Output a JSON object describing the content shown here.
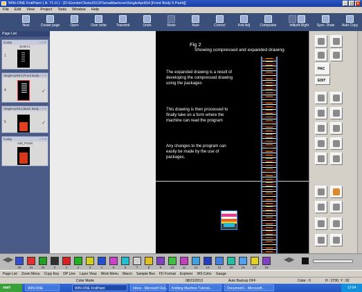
{
  "window": {
    "title": "WIN-ONE KnitPaint ( A: 71 H ) - [D:\\Gordon\\Tests2013\\TamaMaehove\\SingleAprilS4 [Front Body 5 Paint]]",
    "controls": [
      "_",
      "□",
      "×"
    ]
  },
  "menu": [
    "File",
    "Edit",
    "View",
    "Project",
    "Tools",
    "Window",
    "Help"
  ],
  "toolbar": {
    "left": [
      {
        "label": "New",
        "icon": "new-file-icon"
      },
      {
        "label": "Create page",
        "icon": "create-page-icon"
      },
      {
        "label": "Open",
        "icon": "open-folder-icon"
      },
      {
        "label": "Over write",
        "icon": "overwrite-icon"
      },
      {
        "label": "Transmit",
        "icon": "transmit-icon"
      },
      {
        "label": "Undo",
        "icon": "undo-icon"
      },
      {
        "label": "Redo",
        "icon": "redo-icon"
      },
      {
        "label": "Auto",
        "icon": "auto-icon"
      },
      {
        "label": "Correct",
        "icon": "correct-icon"
      },
      {
        "label": "Knit Adj",
        "icon": "knit-adj-icon"
      },
      {
        "label": "Composite",
        "icon": "composite-icon"
      },
      {
        "label": "Info",
        "icon": "info-icon"
      }
    ],
    "right": [
      {
        "label": "Left Right",
        "icon": "left-right-icon"
      },
      {
        "label": "Sync. Draw",
        "icon": "sync-draw-icon"
      },
      {
        "label": "Auto Copy",
        "icon": "auto-copy-icon"
      }
    ]
  },
  "left_panel": {
    "header": "Page List",
    "pages": [
      {
        "title": "Comp",
        "name": "BODY1",
        "num": "1",
        "selected": false
      },
      {
        "title": "SingleAprilS4 [Front Body",
        "name": "",
        "num": "4",
        "selected": true
      },
      {
        "title": "SingleAprilS4 [Back Body",
        "name": "",
        "num": "5",
        "selected": false
      },
      {
        "title": "Comp",
        "name": "Add_Packs",
        "num": "",
        "selected": false
      }
    ]
  },
  "canvas": {
    "fig": "Fig 2",
    "subtitle": "Showing compressed and expanded drawing",
    "paragraphs": [
      "The expanded drawing is a result of developing the compressed drawing using the packages",
      "This drawing is then processed to finally take on a form where the machine can read the program",
      "Any changes to the program can easily be made by the use of packages."
    ]
  },
  "right_panel": {
    "labels": [
      "PAC",
      "EDIT"
    ]
  },
  "color_bar": {
    "swatches": [
      {
        "color": "#3050d0",
        "num": "30"
      },
      {
        "color": "#e03030",
        "num": "31"
      },
      {
        "color": "#20a020",
        "num": "32"
      },
      {
        "color": "#303030",
        "num": "0"
      },
      {
        "color": "#e02020",
        "num": "1"
      },
      {
        "color": "#20b020",
        "num": "2"
      },
      {
        "color": "#d0d020",
        "num": "3"
      },
      {
        "color": "#2050d0",
        "num": "4"
      },
      {
        "color": "#d040d0",
        "num": "5"
      },
      {
        "color": "#20c0d0",
        "num": "6"
      },
      {
        "color": "#d0d0d0",
        "num": "7"
      },
      {
        "color": "#e0c020",
        "num": "8"
      },
      {
        "color": "#8040c0",
        "num": "9"
      },
      {
        "color": "#40c040",
        "num": "10"
      },
      {
        "color": "#c040c0",
        "num": "11"
      },
      {
        "color": "#40a0e0",
        "num": "12"
      },
      {
        "color": "#2040c0",
        "num": "13"
      },
      {
        "color": "#4080e0",
        "num": "14"
      },
      {
        "color": "#20c0a0",
        "num": "15"
      },
      {
        "color": "#50a0f0",
        "num": "16"
      },
      {
        "color": "#e0d020",
        "num": "17"
      },
      {
        "color": "#8040c0",
        "num": "18"
      }
    ]
  },
  "status1": [
    "Page List",
    "Zoom Menu",
    "Copy Key",
    "DP Line",
    "Layer View",
    "Work Menu",
    "Macro",
    "Sample Box",
    "FD Format",
    "Explorer",
    "WS Color",
    "Gauge"
  ],
  "status2": [
    "Color Mode",
    "08/21/2013",
    "Auto Backup OFF",
    "Color : 0",
    "H : 2700, Y : 92"
  ],
  "taskbar": {
    "start": "start",
    "tasks": [
      "WIN-ONE",
      "WIN-ONE KnitPaint",
      "Inbox - Microsoft Out...",
      "Knitting Machine Tutorial...",
      "Document1 - Microsoft..."
    ],
    "clock": "12:04"
  }
}
